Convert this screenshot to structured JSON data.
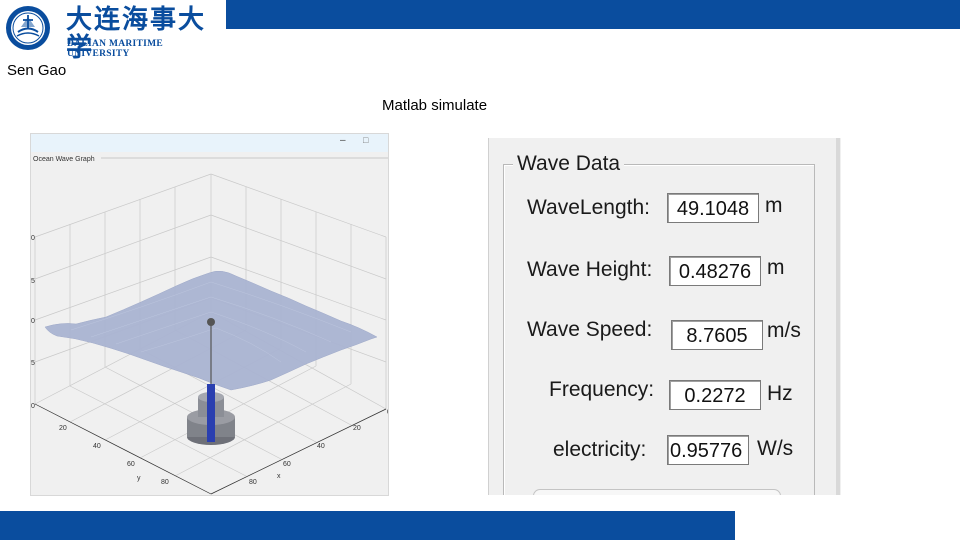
{
  "header": {
    "logo_cn": "大连海事大学",
    "logo_en": "DALIAN MARITIME UNIVERSITY",
    "author": "Sen Gao",
    "caption": "Matlab simulate"
  },
  "figure": {
    "axes_title": "Ocean Wave Graph",
    "x_label": "x",
    "y_label": "y",
    "x_ticks": [
      "0",
      "20",
      "40",
      "60",
      "80",
      "100"
    ],
    "y_ticks": [
      "20",
      "40",
      "60",
      "80",
      "100"
    ],
    "window_buttons": {
      "minimize": "–",
      "maximize": "□"
    }
  },
  "wave_data": {
    "title": "Wave Data",
    "rows": [
      {
        "label": "WaveLength:",
        "value": "49.1048",
        "unit": "m"
      },
      {
        "label": "Wave Height:",
        "value": "0.48276",
        "unit": "m"
      },
      {
        "label": "Wave Speed:",
        "value": "8.7605",
        "unit": "m/s"
      },
      {
        "label": "Frequency:",
        "value": "0.2272",
        "unit": "Hz"
      },
      {
        "label": "electricity:",
        "value": "0.95776",
        "unit": "W/s"
      }
    ]
  },
  "colors": {
    "brand_blue": "#0a4d9e",
    "wave_fill": "#aab4d2",
    "buoy_blue": "#2a3fb0"
  }
}
